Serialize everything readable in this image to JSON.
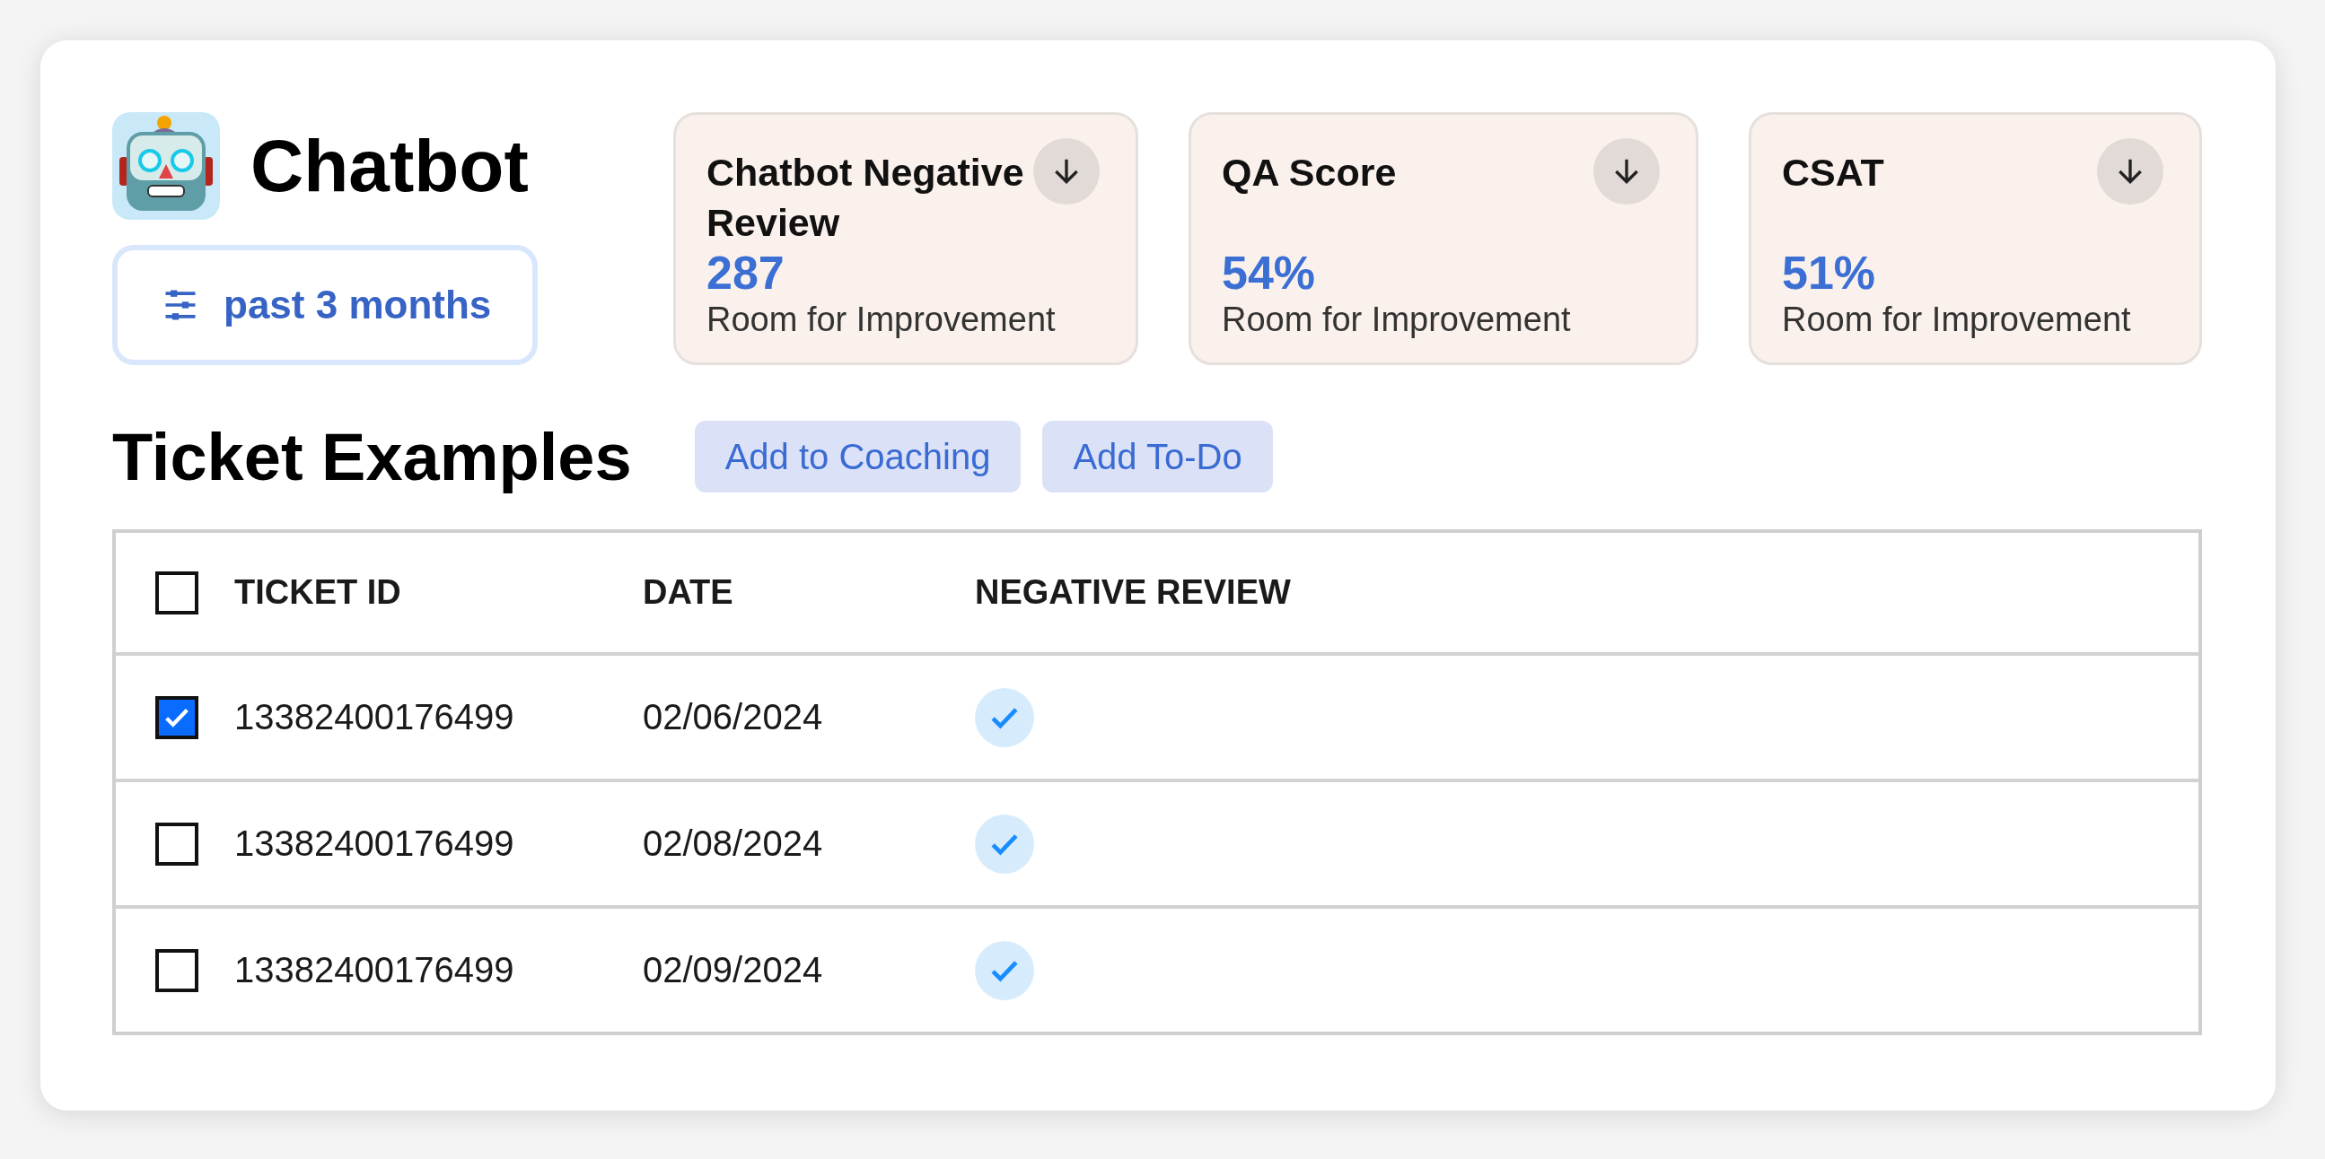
{
  "header": {
    "title": "Chatbot",
    "filter": "past 3 months"
  },
  "metrics": [
    {
      "title": "Chatbot Negative Review",
      "value": "287",
      "caption": "Room for Improvement"
    },
    {
      "title": "QA Score",
      "value": "54%",
      "caption": "Room for Improvement"
    },
    {
      "title": "CSAT",
      "value": "51%",
      "caption": "Room for Improvement"
    }
  ],
  "section": {
    "title": "Ticket Examples",
    "actions": [
      "Add to Coaching",
      "Add To-Do"
    ]
  },
  "table": {
    "select_all_checked": false,
    "columns": [
      "TICKET ID",
      "DATE",
      "NEGATIVE REVIEW"
    ],
    "rows": [
      {
        "checked": true,
        "ticket_id": "13382400176499",
        "date": "02/06/2024",
        "negative_review": true
      },
      {
        "checked": false,
        "ticket_id": "13382400176499",
        "date": "02/08/2024",
        "negative_review": true
      },
      {
        "checked": false,
        "ticket_id": "13382400176499",
        "date": "02/09/2024",
        "negative_review": true
      }
    ]
  }
}
